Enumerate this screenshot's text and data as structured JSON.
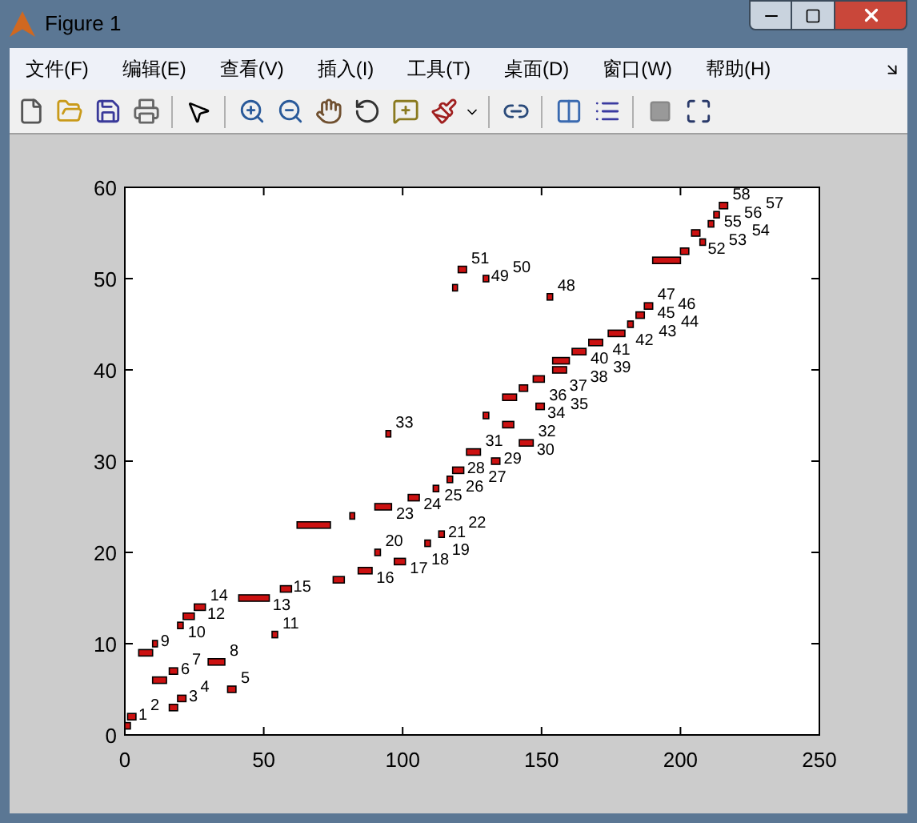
{
  "window": {
    "title": "Figure 1"
  },
  "menu": [
    "文件(F)",
    "编辑(E)",
    "查看(V)",
    "插入(I)",
    "工具(T)",
    "桌面(D)",
    "窗口(W)",
    "帮助(H)"
  ],
  "figure": {
    "y_tick_labels": [
      "60",
      "50",
      "40",
      "30",
      "20",
      "10",
      "0"
    ],
    "x_tick_labels": [
      "0",
      "50",
      "100",
      "150",
      "200",
      "250"
    ],
    "bar_labels": [
      "1",
      "2",
      "3",
      "4",
      "5",
      "6",
      "7",
      "8",
      "9",
      "10",
      "11",
      "12",
      "13",
      "14",
      "15",
      "16",
      "17",
      "18",
      "19",
      "20",
      "21",
      "22",
      "23",
      "24",
      "25",
      "26",
      "27",
      "28",
      "29",
      "30",
      "31",
      "32",
      "33",
      "34",
      "35",
      "36",
      "37",
      "38",
      "39",
      "40",
      "41",
      "42",
      "43",
      "44",
      "45",
      "46",
      "47",
      "48",
      "49",
      "50",
      "51",
      "52",
      "53",
      "54",
      "55",
      "56",
      "57",
      "58"
    ]
  }
}
